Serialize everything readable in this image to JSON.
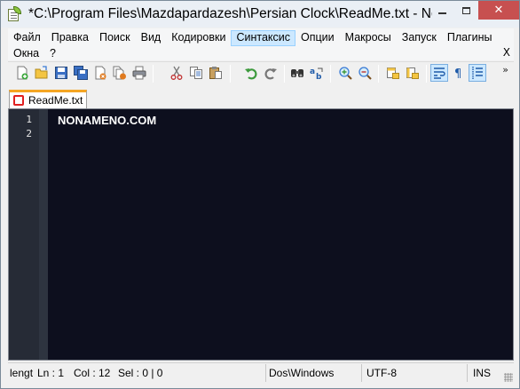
{
  "window": {
    "title": "*C:\\Program Files\\Mazdapardazesh\\Persian Clock\\ReadMe.txt - No...",
    "controls": {
      "minimize": "minimize",
      "maximize": "maximize",
      "close": "✕"
    }
  },
  "menu": {
    "row1": [
      "Файл",
      "Правка",
      "Поиск",
      "Вид",
      "Кодировки",
      "Синтаксис",
      "Опции",
      "Макросы",
      "Запуск",
      "Плагины"
    ],
    "row2": [
      "Окна",
      "?"
    ],
    "active": "Синтаксис",
    "close_label": "X"
  },
  "toolbar": {
    "icons": [
      "new-file-icon",
      "open-file-icon",
      "save-icon",
      "save-all-icon",
      "close-icon",
      "close-all-icon",
      "print-icon",
      "cut-icon",
      "copy-icon",
      "paste-icon",
      "undo-icon",
      "redo-icon",
      "find-icon",
      "replace-icon",
      "zoom-in-icon",
      "zoom-out-icon",
      "sync-vertical-icon",
      "sync-horizontal-icon",
      "word-wrap-icon",
      "show-all-chars-icon",
      "indent-guide-icon"
    ],
    "overflow_label": "»"
  },
  "tabs": [
    {
      "label": "ReadMe.txt",
      "modified": true
    }
  ],
  "editor": {
    "line_numbers": [
      "1",
      "2"
    ],
    "lines": [
      "NONAMENO.COM",
      ""
    ],
    "background": "#0d0f1e",
    "text_color": "#ffffff"
  },
  "status": {
    "length": "lengt",
    "line": "Ln : 1",
    "col": "Col : 12",
    "sel": "Sel : 0 | 0",
    "eol": "Dos\\Windows",
    "encoding": "UTF-8",
    "mode": "INS"
  },
  "colors": {
    "tab_accent": "#f5a623",
    "close_button": "#c75050",
    "menu_highlight": "#cce8ff"
  }
}
